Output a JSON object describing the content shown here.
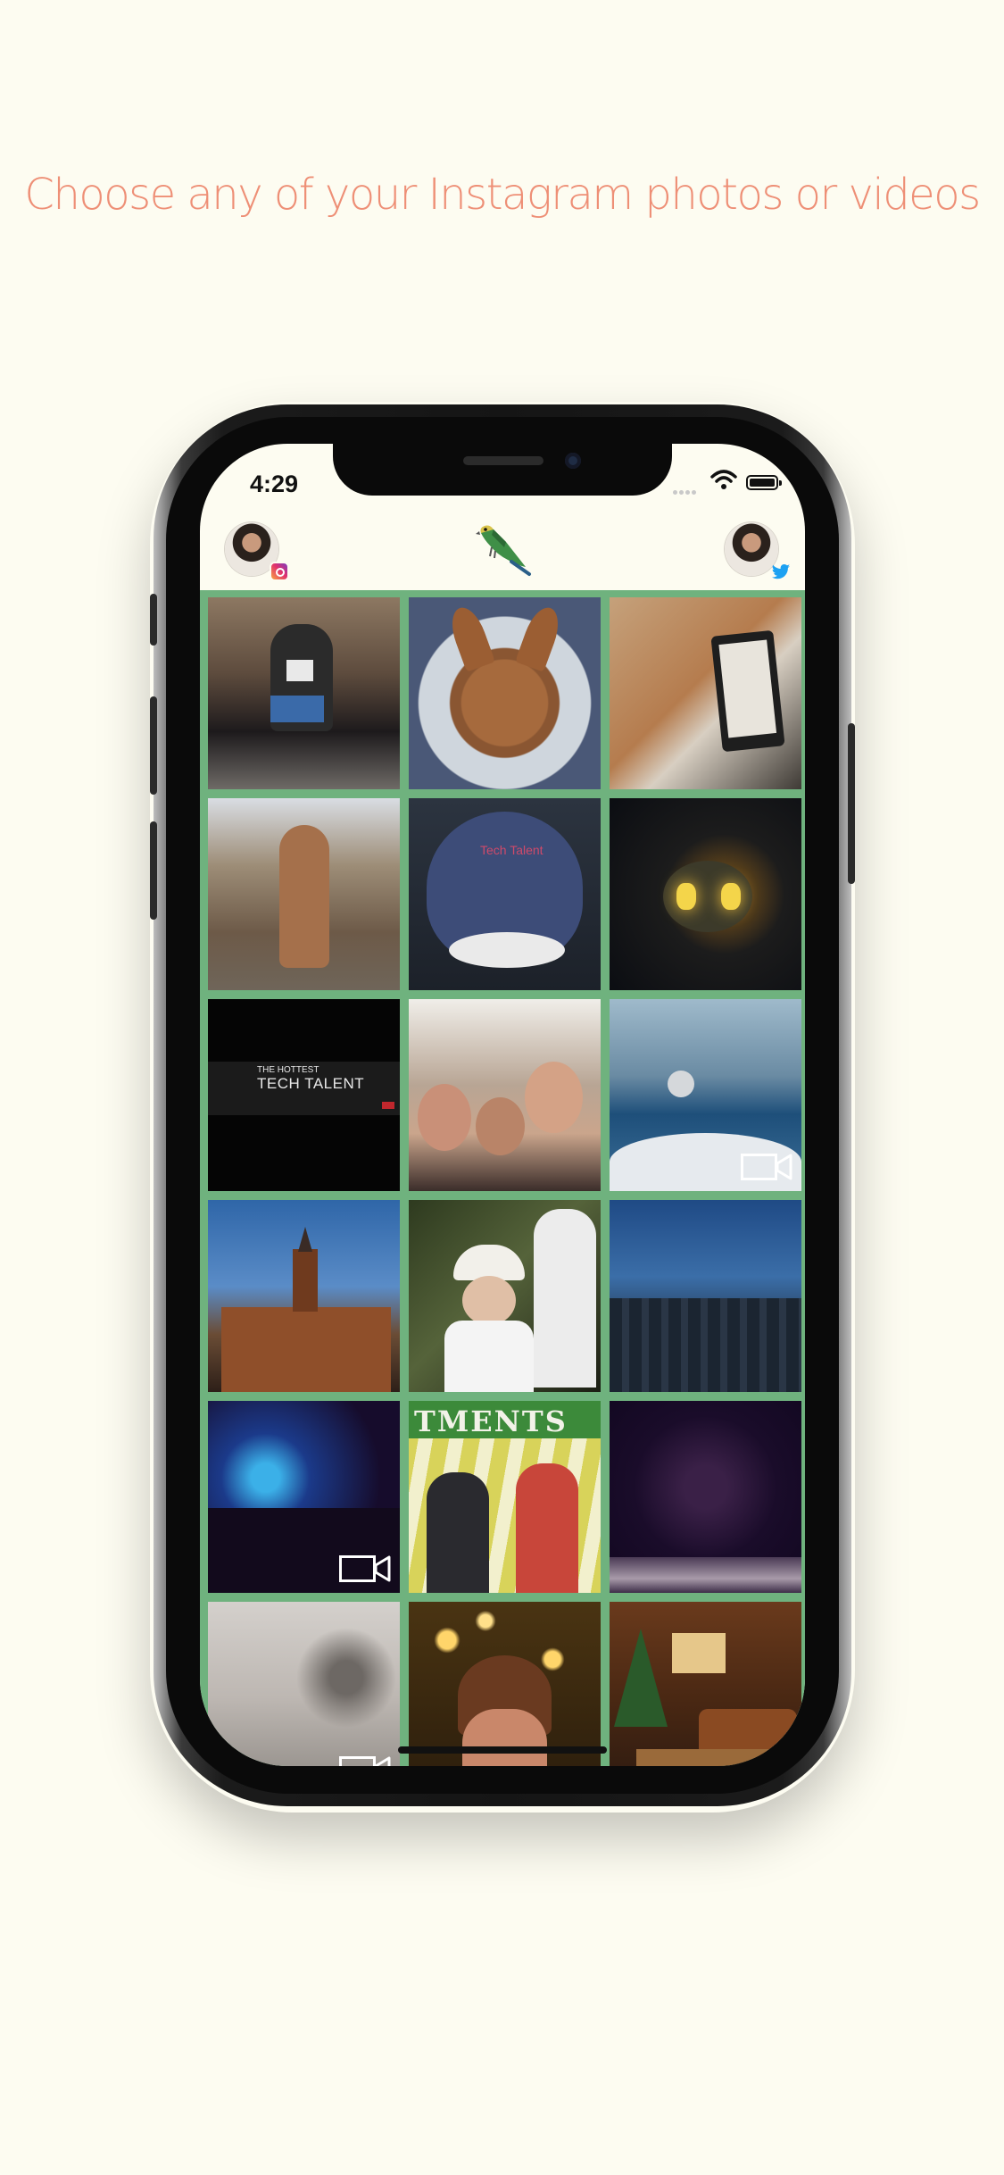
{
  "headline": "Choose any of your Instagram photos or videos",
  "status_bar": {
    "time": "4:29"
  },
  "nav": {
    "left_account_icon": "instagram-icon",
    "center_logo_icon": "parrot-logo-icon",
    "right_account_icon": "twitter-icon"
  },
  "colors": {
    "background": "#fdfcf1",
    "headline": "#ee8f76",
    "grid_border": "#6fb27e"
  },
  "grid": {
    "items": [
      {
        "type": "photo",
        "desc": "man with dog"
      },
      {
        "type": "photo",
        "desc": "dog on bed"
      },
      {
        "type": "photo",
        "desc": "dog with e-reader"
      },
      {
        "type": "photo",
        "desc": "dog on deck"
      },
      {
        "type": "photo",
        "desc": "bike seat",
        "text": "Tech Talent"
      },
      {
        "type": "photo",
        "desc": "pumpkin"
      },
      {
        "type": "photo",
        "desc": "tech talent banner",
        "text_line1": "THE HOTTEST",
        "text_line2": "TECH TALENT"
      },
      {
        "type": "photo",
        "desc": "selfie"
      },
      {
        "type": "video",
        "desc": "boat on water"
      },
      {
        "type": "photo",
        "desc": "building"
      },
      {
        "type": "photo",
        "desc": "child in hat"
      },
      {
        "type": "photo",
        "desc": "city skyline"
      },
      {
        "type": "video",
        "desc": "concert"
      },
      {
        "type": "photo",
        "desc": "award",
        "text": "TMENTS"
      },
      {
        "type": "photo",
        "desc": "dark room"
      },
      {
        "type": "video",
        "desc": "snowy trees"
      },
      {
        "type": "photo",
        "desc": "christmas lights"
      },
      {
        "type": "photo",
        "desc": "living room"
      }
    ]
  }
}
